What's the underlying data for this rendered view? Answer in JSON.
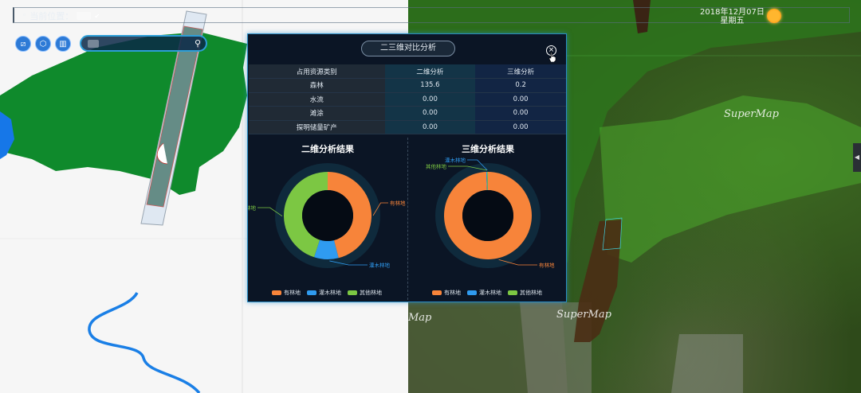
{
  "topbar": {
    "location_label": "当前位置：",
    "date": "2018年12月07日",
    "weekday": "星期五"
  },
  "toolbar": {
    "icons": [
      "layer-icon",
      "cube-icon",
      "split-icon"
    ],
    "search": {
      "value": ""
    }
  },
  "panel": {
    "title": "二三维对比分析",
    "table": {
      "headers": [
        "占用资源类别",
        "二维分析",
        "三维分析"
      ],
      "rows": [
        [
          "森林",
          "135.6",
          "0.2"
        ],
        [
          "水流",
          "0.00",
          "0.00"
        ],
        [
          "滩涂",
          "0.00",
          "0.00"
        ],
        [
          "探明储量矿产",
          "0.00",
          "0.00"
        ]
      ]
    }
  },
  "chart_data": [
    {
      "type": "pie",
      "title": "二维分析结果",
      "categories": [
        "有林地",
        "灌木林地",
        "其他林地"
      ],
      "values": [
        46,
        9,
        45
      ],
      "colors": [
        "#f7843a",
        "#2f9bf0",
        "#7cc743"
      ],
      "legend_position": "bottom"
    },
    {
      "type": "pie",
      "title": "三维分析结果",
      "categories": [
        "有林地",
        "灌木林地",
        "其他林地"
      ],
      "values": [
        99.4,
        0.3,
        0.3
      ],
      "colors": [
        "#f7843a",
        "#2f9bf0",
        "#7cc743"
      ],
      "legend_position": "bottom"
    }
  ],
  "map3d": {
    "watermarks": [
      "SuperMap",
      "SuperMap",
      "Map"
    ]
  }
}
